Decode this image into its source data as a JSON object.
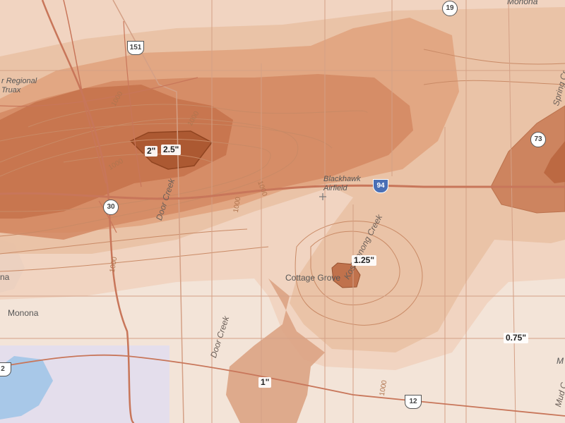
{
  "places": {
    "cottage_grove": "Cottage Grove",
    "monona": "Monona",
    "blackhawk_line1": "Blackhawk",
    "blackhawk_line2": "Airfield",
    "regional_line1": "r Regional",
    "regional_line2": "Truax",
    "monona_top": "Monona",
    "left_edge": "na",
    "edge_m": "M"
  },
  "waterways": {
    "door_creek_north": "Door Creek",
    "door_creek_south": "Door Creek",
    "koshkonong_creek": "Koshkonong Creek",
    "spring_creek": "Spring Cr",
    "mud_creek": "Mud C"
  },
  "contours": [
    "1000",
    "1000",
    "1000",
    "1000",
    "1000",
    "1000",
    "1000"
  ],
  "highways": {
    "us151": "151",
    "us12": "12",
    "hwy19": "19",
    "hwy30": "30",
    "hwy73": "73",
    "i94": "94",
    "hwy12_left": "2"
  },
  "snowfall_labels": {
    "two_inch": "2\"",
    "two_half_inch": "2.5\"",
    "one_quarter_inch": "1.25\"",
    "one_inch": "1\"",
    "three_quarter_inch": "0.75\""
  },
  "colors": {
    "base": "#f3e4d8",
    "band_075": "#f0d6c4",
    "band_1": "#e8b795",
    "band_125": "#dc9a72",
    "band_15": "#d0845a",
    "band_2": "#c16b3e",
    "band_25": "#a8552b",
    "road": "#d9a58a",
    "interstate": "#c8765a",
    "water": "#a8c8e8"
  }
}
